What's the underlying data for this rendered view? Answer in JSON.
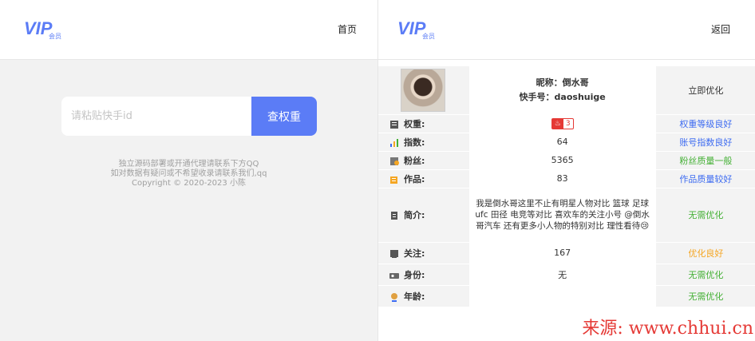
{
  "left": {
    "logo_text": "VIP",
    "logo_sub": "会员",
    "nav_home": "首页",
    "search_placeholder": "请粘贴快手id",
    "search_button": "查权重",
    "footer_line1": "独立源码部署或开通代理请联系下方QQ",
    "footer_line2": "如对数据有疑问或不希望收录请联系我们,qq",
    "footer_line3": "Copyright © 2020-2023 小陈"
  },
  "right": {
    "logo_text": "VIP",
    "logo_sub": "会员",
    "nav_back": "返回",
    "profile": {
      "nickname_line": "昵称：倒水哥",
      "kuaishou_line": "快手号：daoshuige",
      "action": "立即优化"
    },
    "rows": [
      {
        "icon": "weight-icon",
        "label": "权重:",
        "value": "",
        "badge_a": "♨",
        "badge_b": "3",
        "status": "权重等级良好",
        "status_color": "#3d6bf1"
      },
      {
        "icon": "index-chart-icon",
        "label": "指数:",
        "value": "64",
        "status": "账号指数良好",
        "status_color": "#3d6bf1"
      },
      {
        "icon": "fans-icon",
        "label": "粉丝:",
        "value": "5365",
        "status": "粉丝质量一般",
        "status_color": "#44b035"
      },
      {
        "icon": "works-icon",
        "label": "作品:",
        "value": "83",
        "status": "作品质量较好",
        "status_color": "#3d6bf1"
      },
      {
        "icon": "intro-icon",
        "label": "简介:",
        "value": "我是倒水哥这里不止有明星人物对比 篮球 足球 ufc 田径 电竞等对比 喜欢车的关注小号 @倒水哥汽车 还有更多小人物的特别对比 理性看待😢",
        "status": "无需优化",
        "status_color": "#44b035"
      },
      {
        "icon": "follow-icon",
        "label": "关注:",
        "value": "167",
        "status": "优化良好",
        "status_color": "#f5a623"
      },
      {
        "icon": "identity-icon",
        "label": "身份:",
        "value": "无",
        "status": "无需优化",
        "status_color": "#44b035"
      },
      {
        "icon": "age-icon",
        "label": "年龄:",
        "value": "",
        "status": "无需优化",
        "status_color": "#44b035"
      }
    ]
  },
  "watermark": "来源: www.chhui.cn"
}
